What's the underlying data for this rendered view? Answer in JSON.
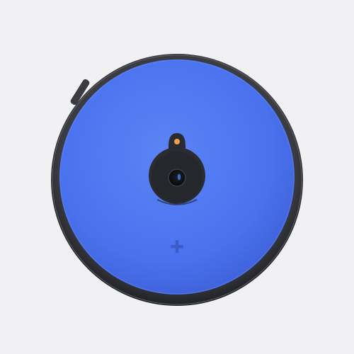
{
  "product": {
    "name": "",
    "colors": {
      "background": "#f1f1f3",
      "shell_rim": "#2e3035",
      "shell_rim_highlight": "#5a5d63",
      "top_cover": "#4a72ef",
      "top_cover_light": "#5c84f5",
      "top_cover_dark": "#3d5fd6",
      "camera_housing": "#2a2c31",
      "camera_lens": "#0c0d10",
      "camera_lens_glint": "#3a7bd5",
      "indicator_led": "#f0a24a",
      "plus_mark": "#3b5cc9",
      "side_button": "#3a3c41"
    },
    "icons": {
      "camera": "camera-lens-icon",
      "led": "status-led-icon",
      "plus": "plus-icon"
    }
  }
}
